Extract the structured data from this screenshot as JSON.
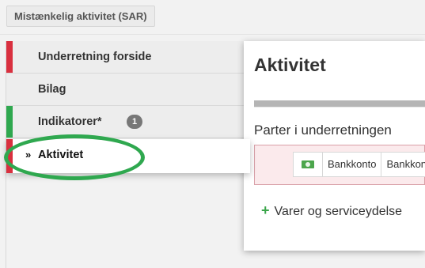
{
  "topbar": {
    "sar_button": "Mistænkelig aktivitet (SAR)"
  },
  "sidebar": {
    "items": [
      {
        "label": "Underretning forside",
        "color": "#d9303f"
      },
      {
        "label": "Bilag",
        "color": ""
      },
      {
        "label": "Indikatorer*",
        "color": "#2fa84f",
        "badge": "1"
      },
      {
        "label": "Aktivitet",
        "color": "#d9303f",
        "chevron": "»",
        "active": true
      }
    ]
  },
  "main": {
    "title": "Aktivitet",
    "section_title": "Parter i underretningen",
    "party_row": {
      "icon": "money-icon",
      "cells": [
        "Bankkonto",
        "Bankkonto"
      ]
    },
    "add_link": {
      "plus": "+",
      "label": "Varer og serviceydelse"
    }
  },
  "colors": {
    "red_accent": "#d9303f",
    "green_accent": "#2fa84f",
    "annotation_circle": "#2fa84f"
  }
}
